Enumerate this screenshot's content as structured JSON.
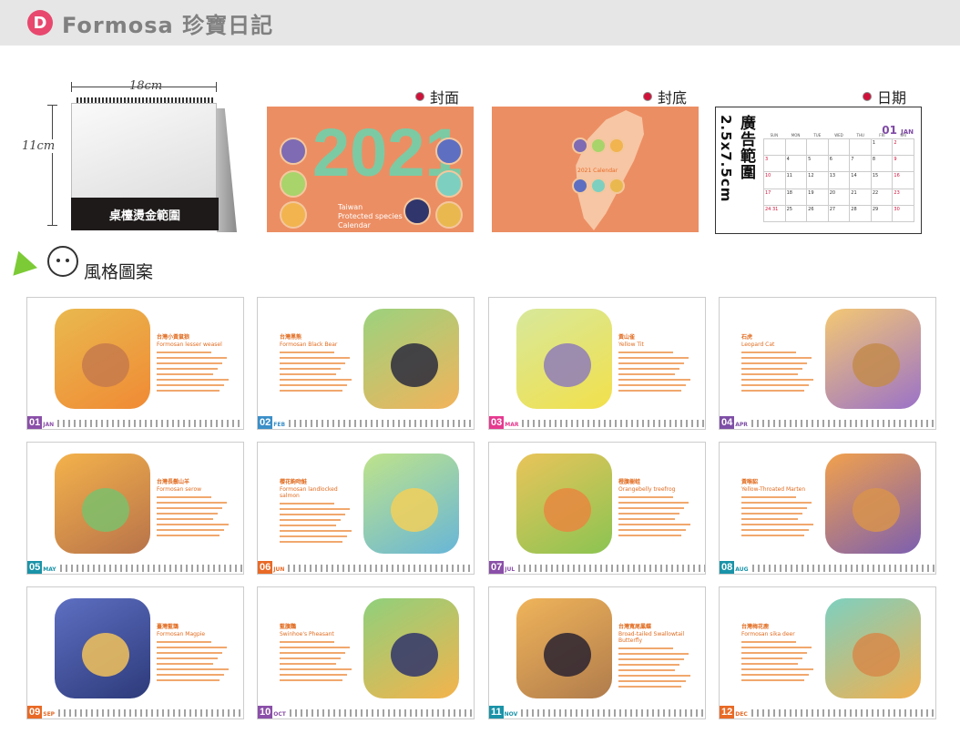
{
  "header": {
    "badge": "D",
    "title": "Formosa 珍寶日記"
  },
  "size": {
    "width_label": "18cm",
    "height_label": "11cm",
    "base_label": "桌檯燙金範圍"
  },
  "panels": {
    "cover_label": "封面",
    "back_label": "封底",
    "date_label": "日期"
  },
  "cover": {
    "year": "2021",
    "caption_line1": "Taiwan",
    "caption_line2": "Protected species",
    "caption_line3": "Calendar"
  },
  "back": {
    "caption": "2021 Calendar"
  },
  "datebox": {
    "ad_text": "廣告範圍",
    "size_text": "2.5x7.5cm",
    "month_num": "01",
    "month_name": "JAN",
    "weekdays": [
      "SUN",
      "MON",
      "TUE",
      "WED",
      "THU",
      "FRI",
      "SAT"
    ],
    "dates": [
      "",
      "",
      "",
      "",
      "",
      "1",
      "2",
      "3",
      "4",
      "5",
      "6",
      "7",
      "8",
      "9",
      "10",
      "11",
      "12",
      "13",
      "14",
      "15",
      "16",
      "17",
      "18",
      "19",
      "20",
      "21",
      "22",
      "23",
      "24 31",
      "25",
      "26",
      "27",
      "28",
      "29",
      "30"
    ]
  },
  "style_section": {
    "title": "風格圖案"
  },
  "months": [
    {
      "num": "01",
      "name": "JAN",
      "color": "#8a4fa8",
      "zh": "台灣小黃鼠狼",
      "en": "Formosan lesser weasel",
      "art": [
        "#e9b94f",
        "#f08a34",
        "#c77a4b"
      ]
    },
    {
      "num": "02",
      "name": "FEB",
      "color": "#3a8fc8",
      "zh": "台灣黑熊",
      "en": "Formosan Black Bear",
      "art": [
        "#9bd27e",
        "#f2b35b",
        "#2b2b3d"
      ]
    },
    {
      "num": "03",
      "name": "MAR",
      "color": "#e6398f",
      "zh": "黃山雀",
      "en": "Yellow Tit",
      "art": [
        "#d7e89b",
        "#f2e04b",
        "#8f7db8"
      ]
    },
    {
      "num": "04",
      "name": "APR",
      "color": "#7e4fa6",
      "zh": "石虎",
      "en": "Leopard Cat",
      "art": [
        "#f4c873",
        "#9b72c8",
        "#c38b4d"
      ]
    },
    {
      "num": "05",
      "name": "MAY",
      "color": "#1a93a8",
      "zh": "台灣長鬃山羊",
      "en": "Formosan serow",
      "art": [
        "#f4b24b",
        "#b8734a",
        "#7dbf6b"
      ]
    },
    {
      "num": "06",
      "name": "JUN",
      "color": "#e86a26",
      "zh": "櫻花鉤吻鮭",
      "en": "Formosan landlocked salmon",
      "art": [
        "#bfe38a",
        "#68b6d8",
        "#f2d05a"
      ]
    },
    {
      "num": "07",
      "name": "JUL",
      "color": "#8a4fa8",
      "zh": "橙腹樹蛙",
      "en": "Orangebelly treefrog",
      "art": [
        "#e9c45a",
        "#8bc452",
        "#e88840"
      ]
    },
    {
      "num": "08",
      "name": "AUG",
      "color": "#1a93a8",
      "zh": "黃喉貂",
      "en": "Yellow-Throated Marten",
      "art": [
        "#f2a14c",
        "#7c5fb0",
        "#d8934e"
      ]
    },
    {
      "num": "09",
      "name": "SEP",
      "color": "#e86a26",
      "zh": "臺灣藍鵲",
      "en": "Formosan Magpie",
      "art": [
        "#5e6fc2",
        "#2d3a7a",
        "#f2c25a"
      ]
    },
    {
      "num": "10",
      "name": "OCT",
      "color": "#8a4fa8",
      "zh": "藍腹鷴",
      "en": "Swinhoe's Pheasant",
      "art": [
        "#8fd07c",
        "#f4b34c",
        "#30356b"
      ]
    },
    {
      "num": "11",
      "name": "NOV",
      "color": "#1a93a8",
      "zh": "台灣寬尾鳳蝶",
      "en": "Broad-tailed Swallowtail Butterfly",
      "art": [
        "#f0b45a",
        "#b07c4c",
        "#2a2230"
      ]
    },
    {
      "num": "12",
      "name": "DEC",
      "color": "#e86a26",
      "zh": "台灣梅花鹿",
      "en": "Formosan sika deer",
      "art": [
        "#7dd0c0",
        "#f1b04f",
        "#d68a4a"
      ]
    }
  ]
}
